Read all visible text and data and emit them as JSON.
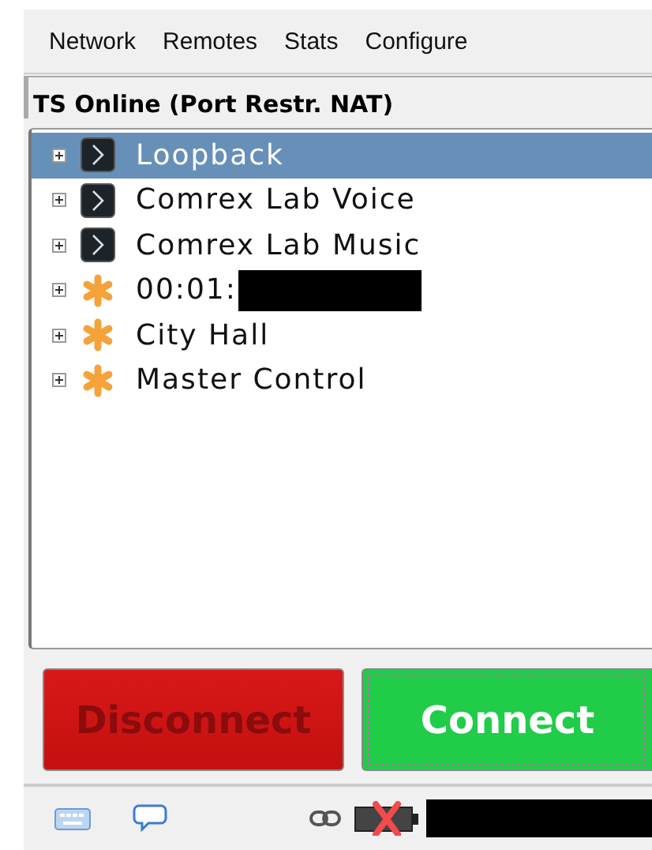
{
  "menu": [
    {
      "label": "Network"
    },
    {
      "label": "Remotes"
    },
    {
      "label": "Stats"
    },
    {
      "label": "Configure"
    }
  ],
  "panel": {
    "title": "TS Online (Port Restr. NAT)"
  },
  "tree": [
    {
      "label": "Loopback",
      "kind": "remote",
      "selected": true,
      "expanded": false,
      "redacted": false
    },
    {
      "label": "Comrex Lab Voice",
      "kind": "remote",
      "selected": false,
      "expanded": false,
      "redacted": false
    },
    {
      "label": "Comrex Lab Music",
      "kind": "remote",
      "selected": false,
      "expanded": false,
      "redacted": false
    },
    {
      "label": "00:01:",
      "kind": "device",
      "selected": false,
      "expanded": false,
      "redacted": true
    },
    {
      "label": "City Hall",
      "kind": "device",
      "selected": false,
      "expanded": false,
      "redacted": false
    },
    {
      "label": "Master Control",
      "kind": "device",
      "selected": false,
      "expanded": false,
      "redacted": false
    }
  ],
  "buttons": [
    {
      "label": "Disconnect",
      "kind": "disconnect",
      "disabled": true,
      "focused": false
    },
    {
      "label": "Connect",
      "kind": "connect",
      "disabled": false,
      "focused": true
    }
  ],
  "status_bar": {
    "battery_error": true,
    "redacted": true
  }
}
